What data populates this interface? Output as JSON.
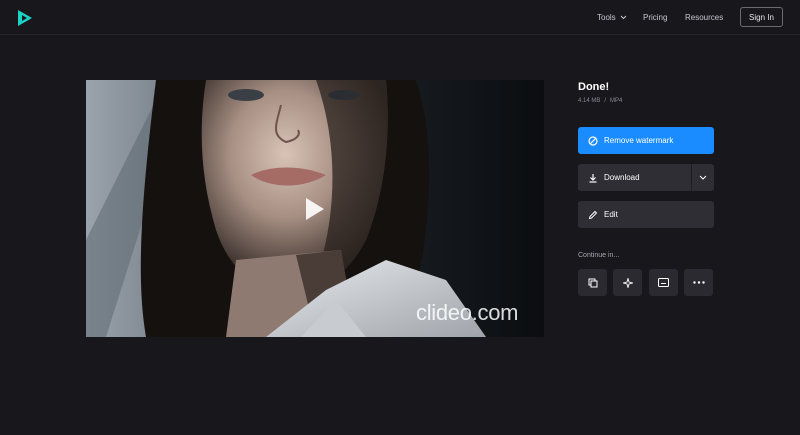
{
  "header": {
    "nav": {
      "tools_label": "Tools",
      "pricing_label": "Pricing",
      "resources_label": "Resources"
    },
    "sign_in_label": "Sign In"
  },
  "preview": {
    "watermark_text": "clideo.com"
  },
  "result": {
    "title": "Done!",
    "file_size": "4.14 MB",
    "separator": "/",
    "file_format": "MP4"
  },
  "actions": {
    "remove_watermark_label": "Remove watermark",
    "download_label": "Download",
    "edit_label": "Edit"
  },
  "continue": {
    "label": "Continue in...",
    "tools": [
      "copy-icon",
      "sparkle-icon",
      "subtitles-icon",
      "more-icon"
    ]
  },
  "colors": {
    "background": "#18171c",
    "accent": "#1a8cff",
    "logo_cyan": "#19d3c5",
    "button_dark": "#2f2e35"
  }
}
